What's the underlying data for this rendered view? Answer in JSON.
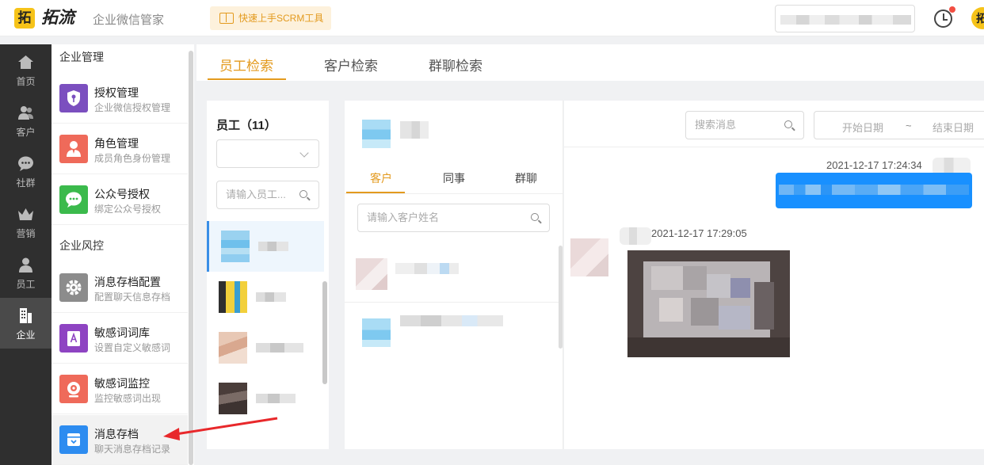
{
  "header": {
    "logo_glyph": "拓",
    "logo_text": "拓流",
    "subtitle": "企业微信管家",
    "quick_start_label": "快速上手SCRM工具",
    "avatar_glyph": "拓"
  },
  "rail": {
    "items": [
      {
        "label": "首页",
        "icon": "home-icon"
      },
      {
        "label": "客户",
        "icon": "customers-icon"
      },
      {
        "label": "社群",
        "icon": "chat-bubble-icon"
      },
      {
        "label": "营销",
        "icon": "crown-icon"
      },
      {
        "label": "员工",
        "icon": "employee-icon"
      },
      {
        "label": "企业",
        "icon": "building-icon",
        "active": true
      }
    ]
  },
  "menu": {
    "section_management": "企业管理",
    "section_risk": "企业风控",
    "items": [
      {
        "name": "授权管理",
        "desc": "企业微信授权管理",
        "icon": "shield-key-icon",
        "color": "#7b4fbf"
      },
      {
        "name": "角色管理",
        "desc": "成员角色身份管理",
        "icon": "person-icon",
        "color": "#ef6a5a"
      },
      {
        "name": "公众号授权",
        "desc": "绑定公众号授权",
        "icon": "wechat-icon",
        "color": "#3bba4c"
      },
      {
        "name": "消息存档配置",
        "desc": "配置聊天信息存档",
        "icon": "gear-icon",
        "color": "#8c8c8c"
      },
      {
        "name": "敏感词词库",
        "desc": "设置自定义敏感词",
        "icon": "dictionary-icon",
        "color": "#8e44c2"
      },
      {
        "name": "敏感词监控",
        "desc": "监控敏感词出现",
        "icon": "camera-icon",
        "color": "#ef6a5a"
      },
      {
        "name": "消息存档",
        "desc": "聊天消息存档记录",
        "icon": "archive-box-icon",
        "color": "#2d8cf0",
        "active": true
      }
    ]
  },
  "tabs": {
    "items": [
      "员工检索",
      "客户检索",
      "群聊检索"
    ],
    "active_index": 0
  },
  "employee_panel": {
    "title": "员工（11）",
    "search_placeholder": "请输入员工..."
  },
  "customer_panel": {
    "sub_tabs": [
      "客户",
      "同事",
      "群聊"
    ],
    "search_placeholder": "请输入客户姓名"
  },
  "chat_panel": {
    "search_placeholder": "搜索消息",
    "start_date_placeholder": "开始日期",
    "range_separator": "~",
    "end_date_placeholder": "结束日期",
    "outgoing_timestamp": "2021-12-17 17:24:34",
    "incoming_timestamp": "2021-12-17 17:29:05"
  },
  "colors": {
    "accent": "#e39a1e",
    "bubble_blue": "#1890ff",
    "arrow_red": "#e8282b"
  }
}
